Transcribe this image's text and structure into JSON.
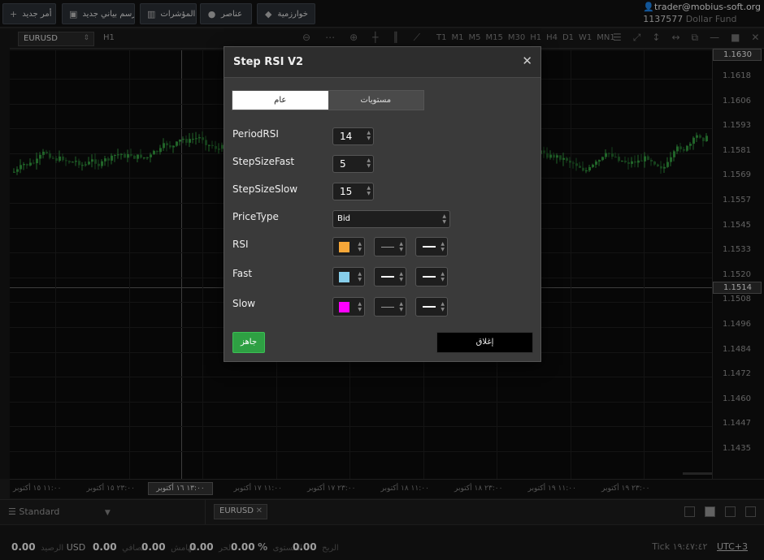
{
  "toolbar": {
    "new_order": "أمر جديد",
    "new_chart": "رسم بياني جديد",
    "indicators": "المؤشرات",
    "elements": "عناصر",
    "algorithms": "خوارزمية"
  },
  "account": {
    "user": "trader@mobius-soft.org",
    "balance": "1137577",
    "fund": "Dollar Fund"
  },
  "chart_toolbar": {
    "symbol": "EURUSD",
    "timeframe": "H1",
    "timeframes": [
      "T1",
      "M1",
      "M5",
      "M15",
      "M30",
      "H1",
      "H4",
      "D1",
      "W1",
      "MN1"
    ]
  },
  "price_axis": {
    "labels": [
      "1.1618",
      "1.1606",
      "1.1593",
      "1.1581",
      "1.1569",
      "1.1557",
      "1.1545",
      "1.1533",
      "1.1520",
      "1.1508",
      "1.1496",
      "1.1484",
      "1.1472",
      "1.1460",
      "1.1447",
      "1.1435"
    ],
    "top_box": "1.1630",
    "current_box": "1.1514"
  },
  "time_axis": {
    "labels": [
      "١١:٠٠ ١٥ أكتوبر",
      "٢٣:٠٠ ١٥ أكتوبر",
      "٢٣:٠٠ ١٦ أكتوبر",
      "١١:٠٠ ١٧ أكتوبر",
      "٢٣:٠٠ ١٧ أكتوبر",
      "١١:٠٠ ١٨ أكتوبر",
      "٢٣:٠٠ ١٨ أكتوبر",
      "١١:٠٠ ١٩ أكتوبر",
      "٢٣:٠٠ ١٩ أكتوبر"
    ],
    "cursor_box": "١٣:٠٠ ١٦ أكتوبر"
  },
  "bottom": {
    "workspace": "Standard",
    "tab": "EURUSD"
  },
  "status": {
    "balance_value": "0.00",
    "currency": "USD",
    "balance_label": "الرصيد",
    "equity_value": "0.00",
    "equity_label": "الصافي",
    "margin_value": "0.00",
    "margin_label": "الهامش",
    "free_value": "0.00",
    "free_label": "الحر",
    "level_value": "0.00",
    "level_pct": "%",
    "level_label": "المستوى",
    "profit_value": "0.00",
    "profit_label": "الربح",
    "tick_label": "Tick",
    "clock": "١٩:٤٧:٤٢",
    "utc": "UTC+3"
  },
  "dialog": {
    "title": "Step RSI V2",
    "tabs": {
      "general": "عام",
      "levels": "مستويات"
    },
    "fields": {
      "period_rsi": {
        "label": "PeriodRSI",
        "value": "14"
      },
      "step_fast": {
        "label": "StepSizeFast",
        "value": "5"
      },
      "step_slow": {
        "label": "StepSizeSlow",
        "value": "15"
      },
      "price_type": {
        "label": "PriceType",
        "value": "Bid"
      }
    },
    "lines": [
      {
        "label": "RSI",
        "color": "#f7a738"
      },
      {
        "label": "Fast",
        "color": "#87ceeb"
      },
      {
        "label": "Slow",
        "color": "#ff00ff"
      }
    ],
    "ok_button": "جاهز",
    "close_button": "إغلاق"
  }
}
